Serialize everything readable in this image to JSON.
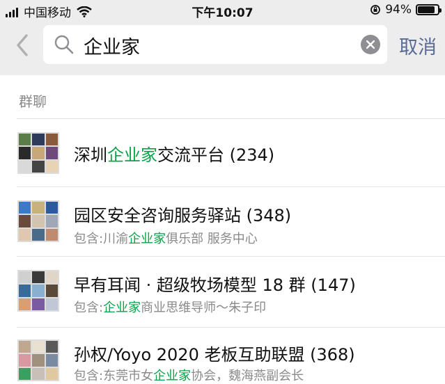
{
  "status_bar": {
    "carrier": "中国移动",
    "time": "下午10:07",
    "battery": "94%",
    "battery_level": 0.94
  },
  "search": {
    "query": "企业家",
    "cancel_label": "取消"
  },
  "section_label": "群聊",
  "results": [
    {
      "title_parts": [
        "深圳",
        "企业家",
        "交流平台 (234)"
      ],
      "sub_parts": []
    },
    {
      "title_parts": [
        "园区安全咨询服务驿站 (348)"
      ],
      "sub_parts": [
        "包含:川渝",
        "企业家",
        "俱乐部 服务中心"
      ]
    },
    {
      "title_parts": [
        "早有耳闻 · 超级牧场模型 18 群 (147)"
      ],
      "sub_parts": [
        "包含:",
        "企业家",
        "商业思维导师～朱子印"
      ]
    },
    {
      "title_parts": [
        "孙权/Yoyo 2020 老板互助联盟 (368)"
      ],
      "sub_parts": [
        "包含:东莞市女",
        "企业家",
        "协会，魏海燕副会长"
      ]
    }
  ],
  "colors": {
    "highlight": "#07a346",
    "link": "#576b95",
    "header_bg": "#ededed"
  },
  "icons": [
    "signal-icon",
    "wifi-icon",
    "rotation-lock-icon",
    "battery-icon",
    "back-chevron-icon",
    "search-icon",
    "clear-icon"
  ]
}
